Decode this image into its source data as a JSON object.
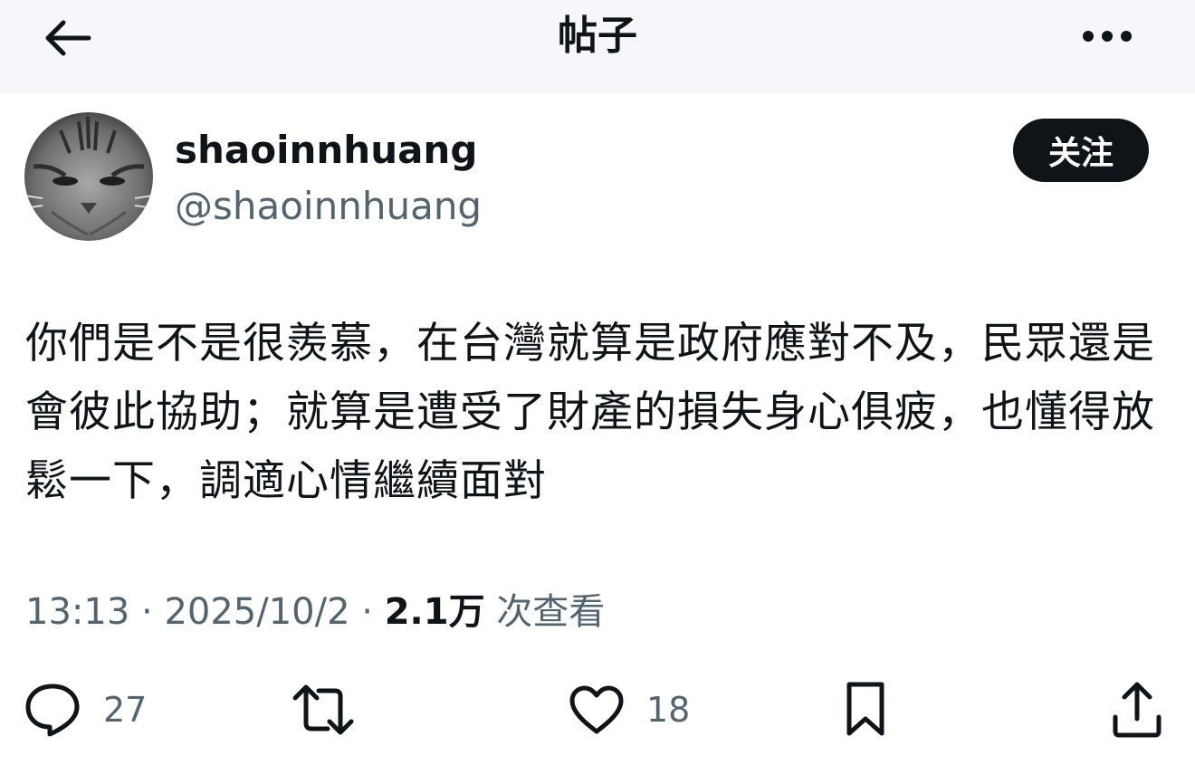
{
  "header": {
    "title": "帖子",
    "back_icon": "arrow-left-icon",
    "more_icon": "more-horizontal-icon"
  },
  "author": {
    "display_name": "shaoinnhuang",
    "handle": "@shaoinnhuang",
    "follow_label": "关注"
  },
  "post": {
    "text": "你們是不是很羨慕，在台灣就算是政府應對不及，民眾還是會彼此協助；就算是遭受了財產的損失身心俱疲，也懂得放鬆一下，調適心情繼續面對",
    "time": "13:13",
    "date": "2025/10/2",
    "views_count": "2.1万",
    "views_label": "次查看"
  },
  "actions": {
    "reply_count": "27",
    "retweet_count": "",
    "like_count": "18"
  },
  "colors": {
    "header_bg": "#f5f7fa",
    "text_primary": "#0f1419",
    "text_secondary": "#536471",
    "follow_bg": "#0f1419"
  }
}
